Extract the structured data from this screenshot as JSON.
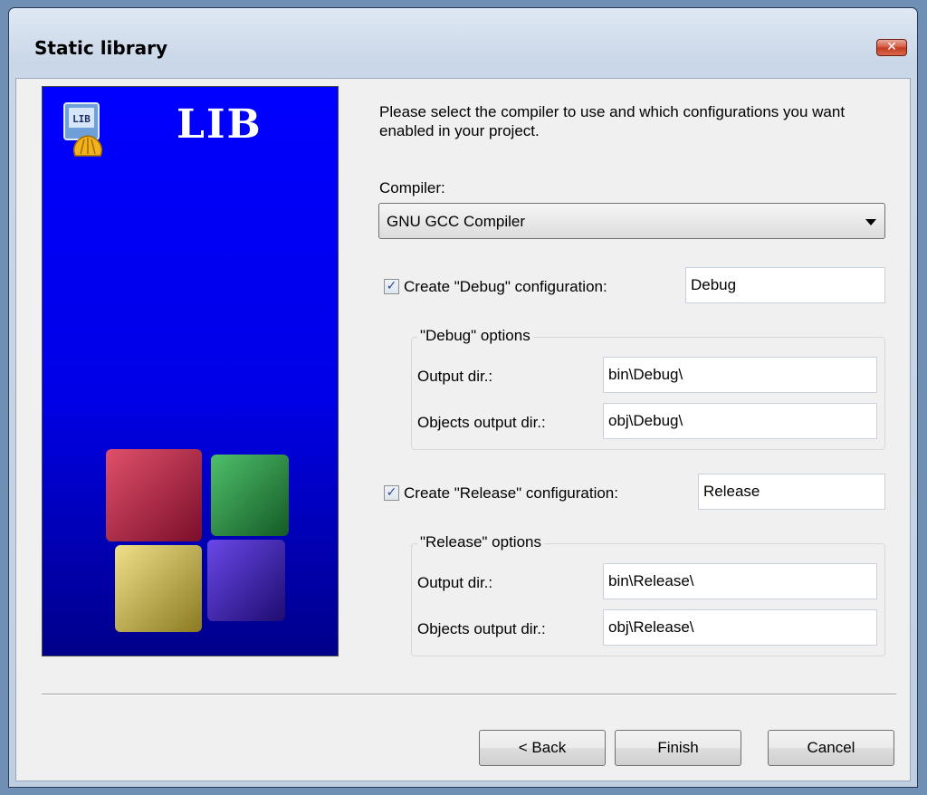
{
  "window": {
    "title": "Static library",
    "close_symbol": "✕"
  },
  "banner": {
    "title": "LIB",
    "icon_label": "LIB"
  },
  "intro_text": "Please select the compiler to use and which configurations you want enabled in your project.",
  "compiler": {
    "label": "Compiler:",
    "value": "GNU GCC Compiler"
  },
  "debug": {
    "checkbox_label": "Create \"Debug\" configuration:",
    "checked": true,
    "name": "Debug",
    "group_label": "\"Debug\" options",
    "output_dir_label": "Output dir.:",
    "output_dir": "bin\\Debug\\",
    "objects_dir_label": "Objects output dir.:",
    "objects_dir": "obj\\Debug\\"
  },
  "release": {
    "checkbox_label": "Create \"Release\" configuration:",
    "checked": true,
    "name": "Release",
    "group_label": "\"Release\" options",
    "output_dir_label": "Output dir.:",
    "output_dir": "bin\\Release\\",
    "objects_dir_label": "Objects output dir.:",
    "objects_dir": "obj\\Release\\"
  },
  "buttons": {
    "back": "< Back",
    "finish": "Finish",
    "cancel": "Cancel"
  },
  "colors": {
    "banner_blue": "#0000ff",
    "cube_red": "#b01c40",
    "cube_green": "#2e8a40",
    "cube_yellow": "#c8b040",
    "cube_purple": "#3a1aa8"
  }
}
